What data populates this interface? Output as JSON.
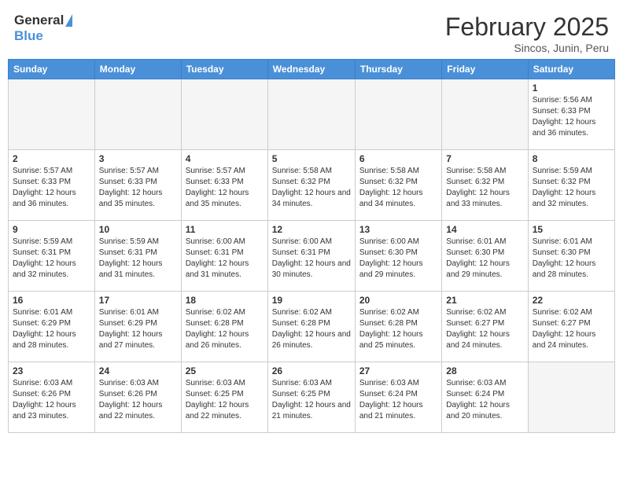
{
  "header": {
    "logo_general": "General",
    "logo_blue": "Blue",
    "month_year": "February 2025",
    "location": "Sincos, Junin, Peru"
  },
  "days_of_week": [
    "Sunday",
    "Monday",
    "Tuesday",
    "Wednesday",
    "Thursday",
    "Friday",
    "Saturday"
  ],
  "weeks": [
    [
      {
        "day": "",
        "info": ""
      },
      {
        "day": "",
        "info": ""
      },
      {
        "day": "",
        "info": ""
      },
      {
        "day": "",
        "info": ""
      },
      {
        "day": "",
        "info": ""
      },
      {
        "day": "",
        "info": ""
      },
      {
        "day": "1",
        "info": "Sunrise: 5:56 AM\nSunset: 6:33 PM\nDaylight: 12 hours and 36 minutes."
      }
    ],
    [
      {
        "day": "2",
        "info": "Sunrise: 5:57 AM\nSunset: 6:33 PM\nDaylight: 12 hours and 36 minutes."
      },
      {
        "day": "3",
        "info": "Sunrise: 5:57 AM\nSunset: 6:33 PM\nDaylight: 12 hours and 35 minutes."
      },
      {
        "day": "4",
        "info": "Sunrise: 5:57 AM\nSunset: 6:33 PM\nDaylight: 12 hours and 35 minutes."
      },
      {
        "day": "5",
        "info": "Sunrise: 5:58 AM\nSunset: 6:32 PM\nDaylight: 12 hours and 34 minutes."
      },
      {
        "day": "6",
        "info": "Sunrise: 5:58 AM\nSunset: 6:32 PM\nDaylight: 12 hours and 34 minutes."
      },
      {
        "day": "7",
        "info": "Sunrise: 5:58 AM\nSunset: 6:32 PM\nDaylight: 12 hours and 33 minutes."
      },
      {
        "day": "8",
        "info": "Sunrise: 5:59 AM\nSunset: 6:32 PM\nDaylight: 12 hours and 32 minutes."
      }
    ],
    [
      {
        "day": "9",
        "info": "Sunrise: 5:59 AM\nSunset: 6:31 PM\nDaylight: 12 hours and 32 minutes."
      },
      {
        "day": "10",
        "info": "Sunrise: 5:59 AM\nSunset: 6:31 PM\nDaylight: 12 hours and 31 minutes."
      },
      {
        "day": "11",
        "info": "Sunrise: 6:00 AM\nSunset: 6:31 PM\nDaylight: 12 hours and 31 minutes."
      },
      {
        "day": "12",
        "info": "Sunrise: 6:00 AM\nSunset: 6:31 PM\nDaylight: 12 hours and 30 minutes."
      },
      {
        "day": "13",
        "info": "Sunrise: 6:00 AM\nSunset: 6:30 PM\nDaylight: 12 hours and 29 minutes."
      },
      {
        "day": "14",
        "info": "Sunrise: 6:01 AM\nSunset: 6:30 PM\nDaylight: 12 hours and 29 minutes."
      },
      {
        "day": "15",
        "info": "Sunrise: 6:01 AM\nSunset: 6:30 PM\nDaylight: 12 hours and 28 minutes."
      }
    ],
    [
      {
        "day": "16",
        "info": "Sunrise: 6:01 AM\nSunset: 6:29 PM\nDaylight: 12 hours and 28 minutes."
      },
      {
        "day": "17",
        "info": "Sunrise: 6:01 AM\nSunset: 6:29 PM\nDaylight: 12 hours and 27 minutes."
      },
      {
        "day": "18",
        "info": "Sunrise: 6:02 AM\nSunset: 6:28 PM\nDaylight: 12 hours and 26 minutes."
      },
      {
        "day": "19",
        "info": "Sunrise: 6:02 AM\nSunset: 6:28 PM\nDaylight: 12 hours and 26 minutes."
      },
      {
        "day": "20",
        "info": "Sunrise: 6:02 AM\nSunset: 6:28 PM\nDaylight: 12 hours and 25 minutes."
      },
      {
        "day": "21",
        "info": "Sunrise: 6:02 AM\nSunset: 6:27 PM\nDaylight: 12 hours and 24 minutes."
      },
      {
        "day": "22",
        "info": "Sunrise: 6:02 AM\nSunset: 6:27 PM\nDaylight: 12 hours and 24 minutes."
      }
    ],
    [
      {
        "day": "23",
        "info": "Sunrise: 6:03 AM\nSunset: 6:26 PM\nDaylight: 12 hours and 23 minutes."
      },
      {
        "day": "24",
        "info": "Sunrise: 6:03 AM\nSunset: 6:26 PM\nDaylight: 12 hours and 22 minutes."
      },
      {
        "day": "25",
        "info": "Sunrise: 6:03 AM\nSunset: 6:25 PM\nDaylight: 12 hours and 22 minutes."
      },
      {
        "day": "26",
        "info": "Sunrise: 6:03 AM\nSunset: 6:25 PM\nDaylight: 12 hours and 21 minutes."
      },
      {
        "day": "27",
        "info": "Sunrise: 6:03 AM\nSunset: 6:24 PM\nDaylight: 12 hours and 21 minutes."
      },
      {
        "day": "28",
        "info": "Sunrise: 6:03 AM\nSunset: 6:24 PM\nDaylight: 12 hours and 20 minutes."
      },
      {
        "day": "",
        "info": ""
      }
    ]
  ]
}
